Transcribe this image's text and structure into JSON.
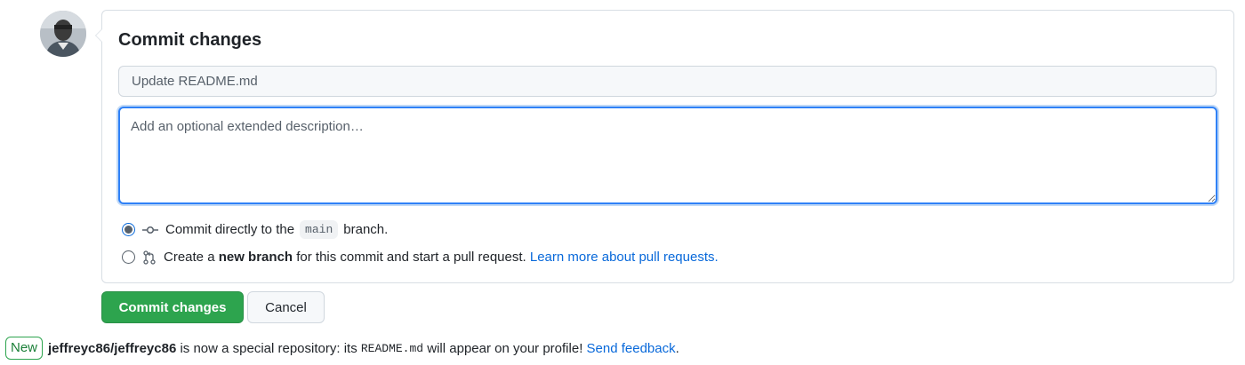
{
  "avatar": {
    "alt": "jeffreyc86 avatar"
  },
  "commit_panel": {
    "title": "Commit changes",
    "summary_placeholder": "Update README.md",
    "description_placeholder": "Add an optional extended description…",
    "option_direct": {
      "prefix": "Commit directly to the",
      "branch": "main",
      "suffix": "branch.",
      "selected": true
    },
    "option_new_branch": {
      "prefix": "Create a",
      "bold": "new branch",
      "suffix": "for this commit and start a pull request.",
      "link": "Learn more about pull requests.",
      "selected": false
    }
  },
  "actions": {
    "commit_label": "Commit changes",
    "cancel_label": "Cancel"
  },
  "notice": {
    "badge": "New",
    "repo": "jeffreyc86/jeffreyc86",
    "text1": "is now a special repository: its",
    "file": "README.md",
    "text2": "will appear on your profile!",
    "link": "Send feedback",
    "end": "."
  },
  "colors": {
    "primary_green": "#2da44e",
    "link_blue": "#0969da",
    "focus_blue": "#2f81f7"
  },
  "icons": {
    "commit": "git-commit-icon",
    "pull_request": "git-pull-request-icon"
  }
}
